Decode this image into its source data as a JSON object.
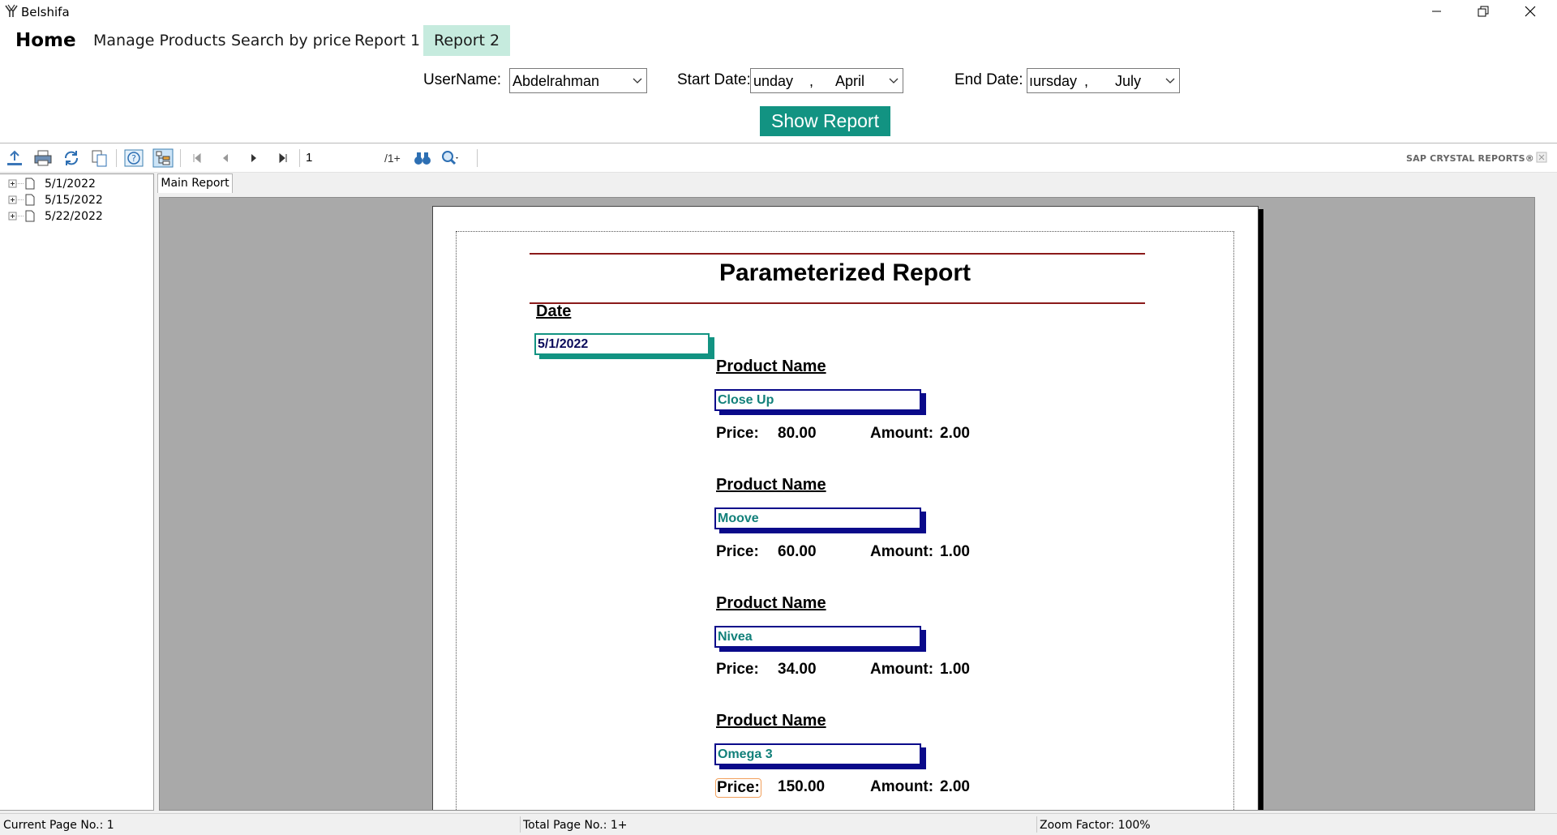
{
  "window": {
    "title": "Belshifa"
  },
  "menu": {
    "home": "Home",
    "manage_products": "Manage Products",
    "search_by_price": "Search by price",
    "report1": "Report 1",
    "report2": "Report 2"
  },
  "params": {
    "username_label": "UserName:",
    "username_value": "Abdelrahman",
    "start_label": "Start Date:",
    "start_day": "unday",
    "start_sep": ",",
    "start_month": "April",
    "end_label": "End Date:",
    "end_day": "ıursday",
    "end_sep": ",",
    "end_month": "July",
    "show_button": "Show Report"
  },
  "toolbar": {
    "page_value": "1",
    "page_total": "/1+",
    "brand": "SAP CRYSTAL REPORTS®"
  },
  "tree": {
    "items": [
      {
        "label": "5/1/2022"
      },
      {
        "label": "5/15/2022"
      },
      {
        "label": "5/22/2022"
      }
    ]
  },
  "tab": {
    "label": "Main Report"
  },
  "report": {
    "title": "Parameterized Report",
    "date_header": "Date",
    "date_value": "5/1/2022",
    "product_header": "Product Name",
    "price_label": "Price:",
    "amount_label": "Amount:",
    "products": [
      {
        "name": "Close Up",
        "price": "80.00",
        "amount": "2.00"
      },
      {
        "name": "Moove",
        "price": "60.00",
        "amount": "1.00"
      },
      {
        "name": "Nivea",
        "price": "34.00",
        "amount": "1.00"
      },
      {
        "name": "Omega 3",
        "price": "150.00",
        "amount": "2.00"
      }
    ]
  },
  "status": {
    "current_page": "Current Page No.: 1",
    "total_page": "Total Page No.: 1+",
    "zoom": "Zoom Factor: 100%"
  },
  "colors": {
    "accent_teal": "#129382",
    "selected_menu": "#c6ebde",
    "report_rule": "#8b1a1a",
    "product_border": "#0a0a8a"
  }
}
